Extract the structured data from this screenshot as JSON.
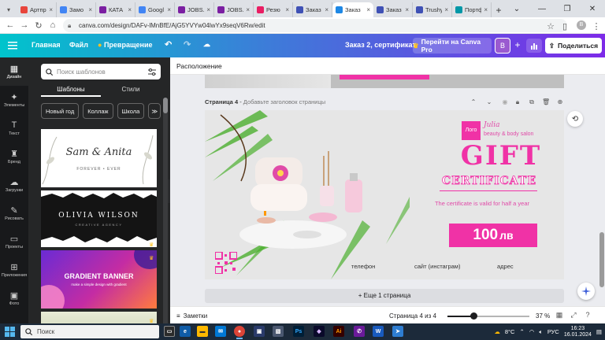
{
  "browser": {
    "tabs": [
      {
        "title": "Артпр",
        "color": "#e8453c"
      },
      {
        "title": "Замо",
        "color": "#4285f4"
      },
      {
        "title": "КАТА",
        "color": "#7b1fa2"
      },
      {
        "title": "Googl",
        "color": "#4285f4"
      },
      {
        "title": "JOBS.",
        "color": "#7b1fa2"
      },
      {
        "title": "JOBS.",
        "color": "#7b1fa2"
      },
      {
        "title": "Резю",
        "color": "#e91e63"
      },
      {
        "title": "Заказ",
        "color": "#3f51b5"
      },
      {
        "title": "Заказ",
        "color": "#1e88e5",
        "active": true
      },
      {
        "title": "Заказ",
        "color": "#3f51b5"
      },
      {
        "title": "Trushy",
        "color": "#3f51b5"
      },
      {
        "title": "Портф",
        "color": "#0097a7"
      }
    ],
    "new_tab": "+",
    "url": "canva.com/design/DAFv-lMnBfE/AjG5YVYw04lwYx9seqV6Rw/edit"
  },
  "canva_header": {
    "home": "Главная",
    "file": "Файл",
    "transform": "Превращение",
    "doc_title": "Заказ 2, сертификат",
    "go_pro": "Перейти на Canva Pro",
    "avatar_letter": "В",
    "share": "Поделиться"
  },
  "rail": [
    {
      "label": "Дизайн",
      "icon": "design-icon",
      "active": true
    },
    {
      "label": "Элементы",
      "icon": "elements-icon"
    },
    {
      "label": "Текст",
      "icon": "text-icon"
    },
    {
      "label": "Бренд",
      "icon": "brand-icon"
    },
    {
      "label": "Загрузки",
      "icon": "uploads-icon"
    },
    {
      "label": "Рисовать",
      "icon": "draw-icon"
    },
    {
      "label": "Проекты",
      "icon": "projects-icon"
    },
    {
      "label": "Приложения",
      "icon": "apps-icon"
    },
    {
      "label": "Фото",
      "icon": "photos-icon"
    }
  ],
  "panel": {
    "search_placeholder": "Поиск шаблонов",
    "tab_templates": "Шаблоны",
    "tab_styles": "Стили",
    "chips": [
      "Новый год",
      "Коллаж",
      "Школа"
    ],
    "templates": {
      "t1_line1": "Sam & Anita",
      "t1_line2": "FOREVER • EVER",
      "t2_line1": "OLIVIA WILSON",
      "t2_line2": "CREATIVE AGENCY",
      "t3_line1": "GRADIENT BANNER",
      "t3_line2": "make a simple design with gradient"
    }
  },
  "toolbar": {
    "label": "Расположение"
  },
  "page": {
    "number_label": "Страница 4",
    "title_placeholder": "Добавьте заголовок страницы"
  },
  "certificate": {
    "logo": "Лого",
    "salon_name": "Julia",
    "salon_sub": "beauty & body salon",
    "gift": "GIFT",
    "certificate": "CERTIFICATE",
    "valid": "The certificate is valid for half a year",
    "amount": "100",
    "currency": "лв",
    "phone": "телефон",
    "site": "сайт (инстаграм)",
    "address": "адрес",
    "colors": {
      "pink": "#f032a6",
      "light_pink": "#f6a6d8",
      "text_pink": "#e04ba8"
    }
  },
  "add_page": "+ Еще 1 страница",
  "status": {
    "notes": "Заметки",
    "page_count": "Страница 4 из 4",
    "zoom": "37 %",
    "zoom_fraction": 0.3
  },
  "taskbar": {
    "search": "Поиск",
    "weather": "8°C",
    "lang": "РУС",
    "time": "16:23",
    "date": "16.01.2024"
  }
}
